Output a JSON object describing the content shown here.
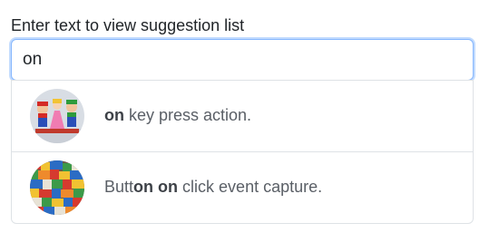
{
  "label": "Enter text to view suggestion list",
  "input": {
    "value": "on"
  },
  "suggestions": [
    {
      "image": "mario-characters-avatar",
      "pre": "",
      "match": "on",
      "mid": "",
      "match2": "",
      "post": " key press action."
    },
    {
      "image": "lego-bricks-avatar",
      "pre": "Butt",
      "match": "on",
      "mid": " ",
      "match2": "on",
      "post": " click event capture."
    }
  ]
}
